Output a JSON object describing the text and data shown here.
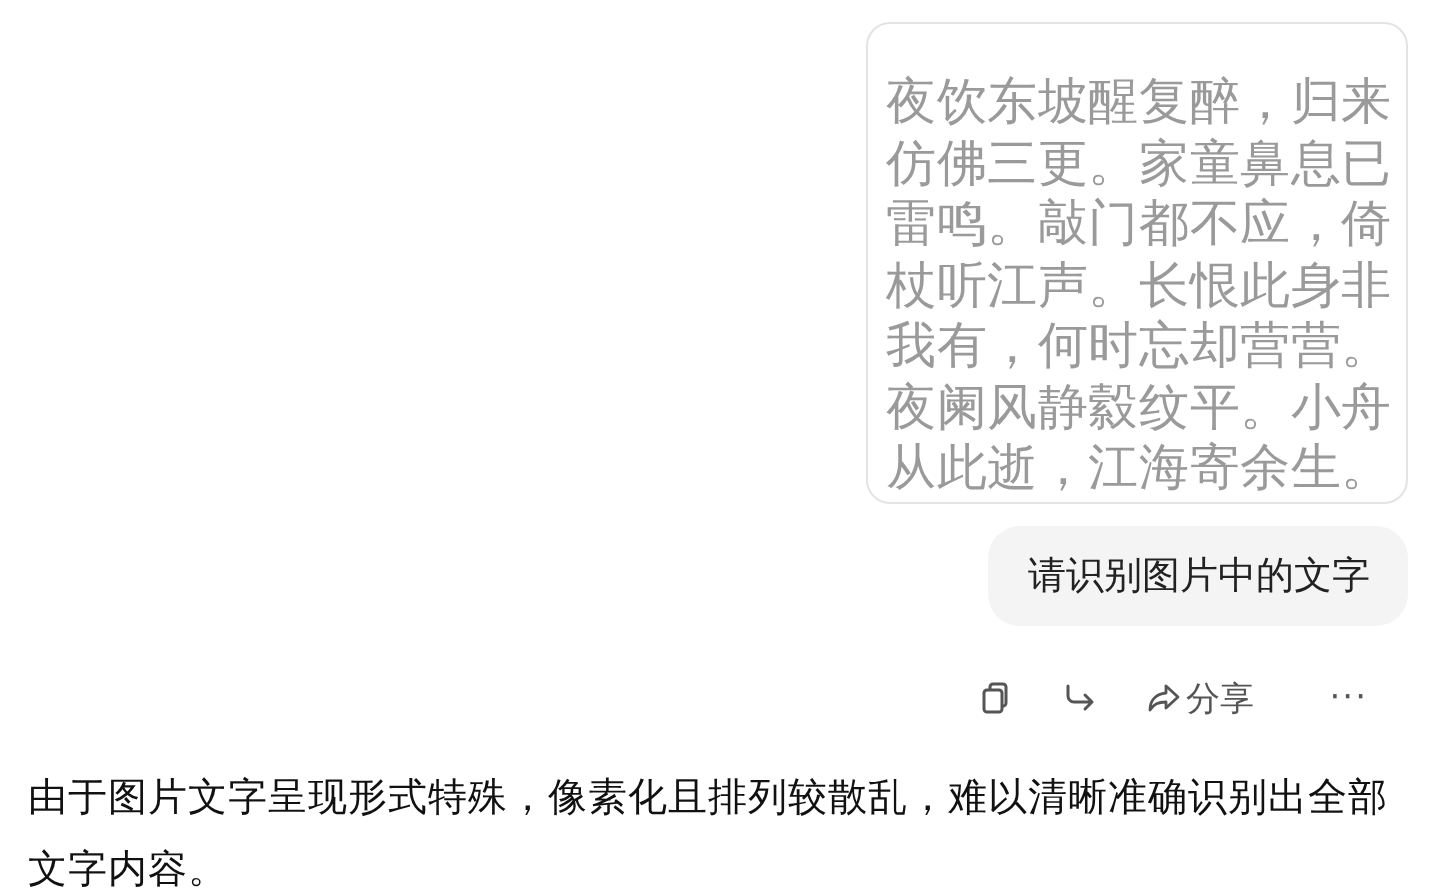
{
  "user_message": {
    "image_lines": [
      "夜饮东坡醒复醉，归来",
      "仿佛三更。家童鼻息已",
      "雷鸣。敲门都不应，倚",
      "杖听江声。长恨此身非",
      "我有，何时忘却营营。",
      "夜阑风静縠纹平。小舟",
      "从此逝，江海寄余生。"
    ],
    "text": "请识别图片中的文字"
  },
  "actions": [
    {
      "kind": "copy"
    },
    {
      "kind": "forward"
    },
    {
      "kind": "share",
      "label": "分享"
    },
    {
      "kind": "more",
      "label": "···"
    }
  ],
  "reply": {
    "text": "由于图片文字呈现形式特殊，像素化且排列较散乱，难以清晰准确识别出全部文字内容。"
  }
}
